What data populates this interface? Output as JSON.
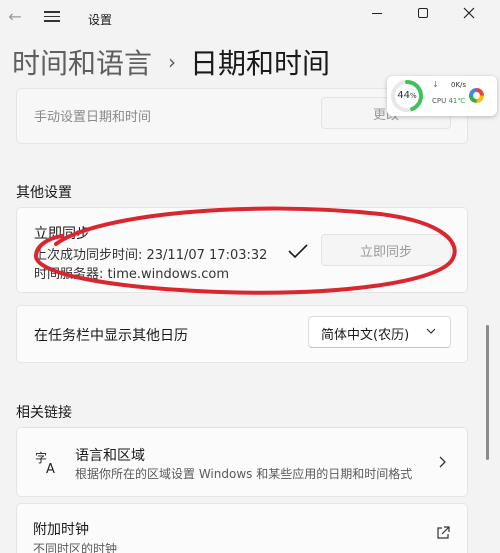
{
  "window": {
    "title": "设置"
  },
  "breadcrumb": {
    "parent": "时间和语言",
    "current": "日期和时间"
  },
  "widget": {
    "cpu_percent": 44,
    "percent_label": "44",
    "percent_unit": "%",
    "net_speed": "0K/s",
    "cpu_label": "CPU",
    "cpu_temp": "41℃"
  },
  "manual_time": {
    "label": "手动设置日期和时间",
    "button": "更改"
  },
  "other_settings": {
    "title": "其他设置",
    "sync": {
      "title": "立即同步",
      "last_sync": "上次成功同步时间: 23/11/07 17:03:32",
      "server": "时间服务器: time.windows.com",
      "button": "立即同步"
    },
    "calendar": {
      "label": "在任务栏中显示其他日历",
      "value": "简体中文(农历)"
    }
  },
  "related_links": {
    "title": "相关链接",
    "language_region": {
      "title": "语言和区域",
      "description": "根据你所在的区域设置 Windows 和某些应用的日期和时间格式"
    },
    "additional_clocks": {
      "title": "附加时钟",
      "description": "不同时区的时钟"
    }
  },
  "colors": {
    "annotation_red": "#d9262f",
    "gauge_green": "#3fc25a",
    "temp_green": "#2e9e3e"
  }
}
